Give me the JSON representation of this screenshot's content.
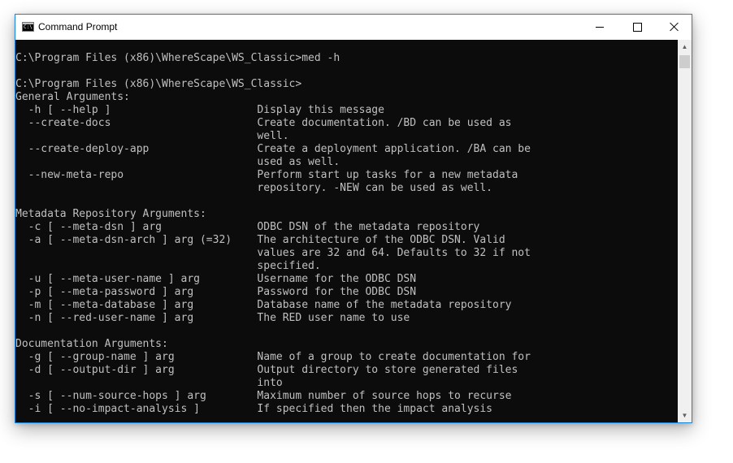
{
  "window": {
    "title": "Command Prompt",
    "icon": "cmd-prompt-icon",
    "icon_text": "C:\\"
  },
  "controls": {
    "minimize": "minimize-icon",
    "maximize": "maximize-icon",
    "close": "close-icon"
  },
  "console": {
    "lines": [
      "C:\\Program Files (x86)\\WhereScape\\WS_Classic>med -h",
      "",
      "C:\\Program Files (x86)\\WhereScape\\WS_Classic>",
      "General Arguments:",
      "  -h [ --help ]                       Display this message",
      "  --create-docs                       Create documentation. /BD can be used as",
      "                                      well.",
      "  --create-deploy-app                 Create a deployment application. /BA can be",
      "                                      used as well.",
      "  --new-meta-repo                     Perform start up tasks for a new metadata",
      "                                      repository. -NEW can be used as well.",
      "",
      "Metadata Repository Arguments:",
      "  -c [ --meta-dsn ] arg               ODBC DSN of the metadata repository",
      "  -a [ --meta-dsn-arch ] arg (=32)    The architecture of the ODBC DSN. Valid",
      "                                      values are 32 and 64. Defaults to 32 if not",
      "                                      specified.",
      "  -u [ --meta-user-name ] arg         Username for the ODBC DSN",
      "  -p [ --meta-password ] arg          Password for the ODBC DSN",
      "  -m [ --meta-database ] arg          Database name of the metadata repository",
      "  -n [ --red-user-name ] arg          The RED user name to use",
      "",
      "Documentation Arguments:",
      "  -g [ --group-name ] arg             Name of a group to create documentation for",
      "  -d [ --output-dir ] arg             Output directory to store generated files",
      "                                      into",
      "  -s [ --num-source-hops ] arg        Maximum number of source hops to recurse",
      "  -i [ --no-impact-analysis ]         If specified then the impact analysis"
    ]
  },
  "scrollbar": {
    "up_icon": "scroll-up-arrow-icon",
    "down_icon": "scroll-down-arrow-icon"
  },
  "colors": {
    "console_bg": "#0c0c0c",
    "console_text": "#c0c0c0",
    "window_border": "#1883d7"
  }
}
